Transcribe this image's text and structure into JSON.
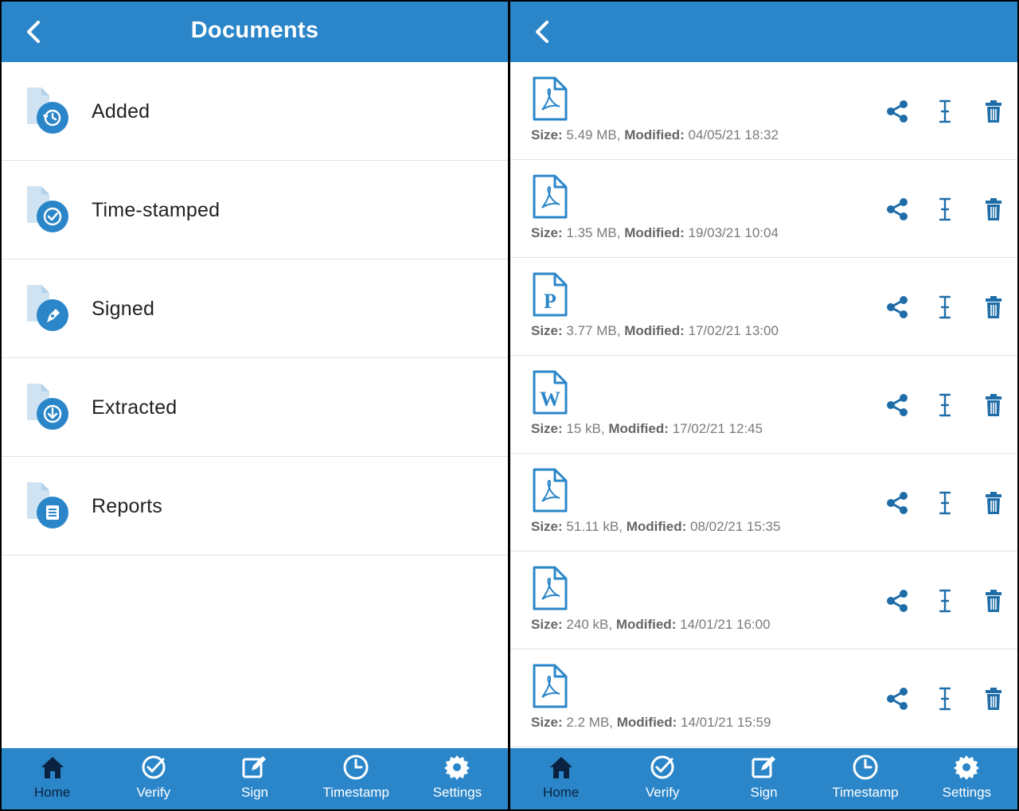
{
  "colors": {
    "accent": "#2b86c9",
    "active_nav": "#0a2240",
    "icon_dark": "#1f6da8"
  },
  "left": {
    "title": "Documents",
    "categories": [
      {
        "label": "Added",
        "icon": "history-icon"
      },
      {
        "label": "Time-stamped",
        "icon": "check-circle-icon"
      },
      {
        "label": "Signed",
        "icon": "pen-icon"
      },
      {
        "label": "Extracted",
        "icon": "download-icon"
      },
      {
        "label": "Reports",
        "icon": "report-icon"
      }
    ]
  },
  "right": {
    "files": [
      {
        "type": "pdf",
        "size_label": "Size:",
        "size": "5.49 MB,",
        "mod_label": "Modified:",
        "modified": "04/05/21 18:32"
      },
      {
        "type": "pdf",
        "size_label": "Size:",
        "size": "1.35 MB,",
        "mod_label": "Modified:",
        "modified": "19/03/21 10:04"
      },
      {
        "type": "p",
        "size_label": "Size:",
        "size": "3.77 MB,",
        "mod_label": "Modified:",
        "modified": "17/02/21 13:00"
      },
      {
        "type": "w",
        "size_label": "Size:",
        "size": "15 kB,",
        "mod_label": "Modified:",
        "modified": "17/02/21 12:45"
      },
      {
        "type": "pdf",
        "size_label": "Size:",
        "size": "51.11 kB,",
        "mod_label": "Modified:",
        "modified": "08/02/21 15:35"
      },
      {
        "type": "pdf",
        "size_label": "Size:",
        "size": "240 kB,",
        "mod_label": "Modified:",
        "modified": "14/01/21 16:00"
      },
      {
        "type": "pdf",
        "size_label": "Size:",
        "size": "2.2 MB,",
        "mod_label": "Modified:",
        "modified": "14/01/21 15:59"
      }
    ]
  },
  "nav": {
    "home": "Home",
    "verify": "Verify",
    "sign": "Sign",
    "timestamp": "Timestamp",
    "settings": "Settings",
    "active": "home"
  }
}
